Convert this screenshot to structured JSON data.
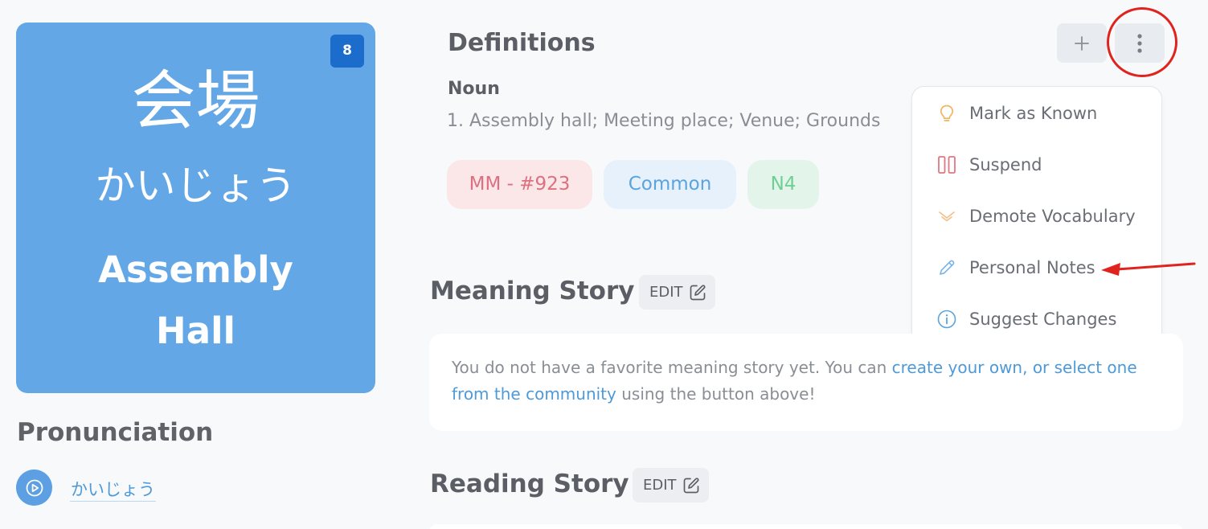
{
  "card": {
    "level_badge": "8",
    "kanji": "会場",
    "kana": "かいじょう",
    "meaning": "Assembly Hall",
    "background_color": "#63a7e6"
  },
  "pronunciation": {
    "title": "Pronunciation",
    "reading": "かいじょう",
    "play_icon": "play-icon"
  },
  "definitions": {
    "title": "Definitions",
    "part_of_speech": "Noun",
    "gloss": "1. Assembly hall; Meeting place; Venue; Grounds",
    "tags": [
      "MM - #923",
      "Common",
      "N4"
    ],
    "add_icon": "plus-icon",
    "more_icon": "vertical-dots-icon"
  },
  "menu": {
    "items": [
      {
        "label": "Mark as Known",
        "icon": "lightbulb-icon"
      },
      {
        "label": "Suspend",
        "icon": "pause-icon"
      },
      {
        "label": "Demote Vocabulary",
        "icon": "chevron-down-icon"
      },
      {
        "label": "Personal Notes",
        "icon": "pencil-icon"
      },
      {
        "label": "Suggest Changes",
        "icon": "info-icon"
      }
    ]
  },
  "meaning_story": {
    "title": "Meaning Story",
    "edit_label": "EDIT",
    "text_before": "You do not have a favorite meaning story yet. You can ",
    "link_text": "create your own, or select one from the community",
    "text_after": " using the button above!"
  },
  "reading_story": {
    "title": "Reading Story",
    "edit_label": "EDIT"
  },
  "annotation_color": "#e0231c"
}
